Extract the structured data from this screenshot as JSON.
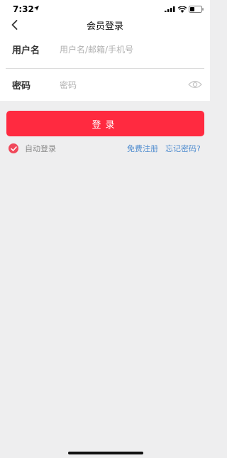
{
  "status_bar": {
    "time": "7:32",
    "icons": [
      "location-arrow-icon",
      "signal-icon",
      "wifi-icon",
      "battery-icon"
    ]
  },
  "nav": {
    "title": "会员登录",
    "back_icon": "chevron-left-icon"
  },
  "form": {
    "username": {
      "label": "用户名",
      "placeholder": "用户名/邮箱/手机号",
      "value": ""
    },
    "password": {
      "label": "密码",
      "placeholder": "密码",
      "value": "",
      "toggle_icon": "eye-icon"
    }
  },
  "login_button": {
    "label": "登录"
  },
  "options": {
    "auto_login": {
      "label": "自动登录",
      "checked": true
    },
    "register_link": "免费注册",
    "forgot_link": "忘记密码?"
  },
  "colors": {
    "accent": "#ff2a40",
    "link": "#4f8ccf",
    "background": "#eeeeef"
  }
}
